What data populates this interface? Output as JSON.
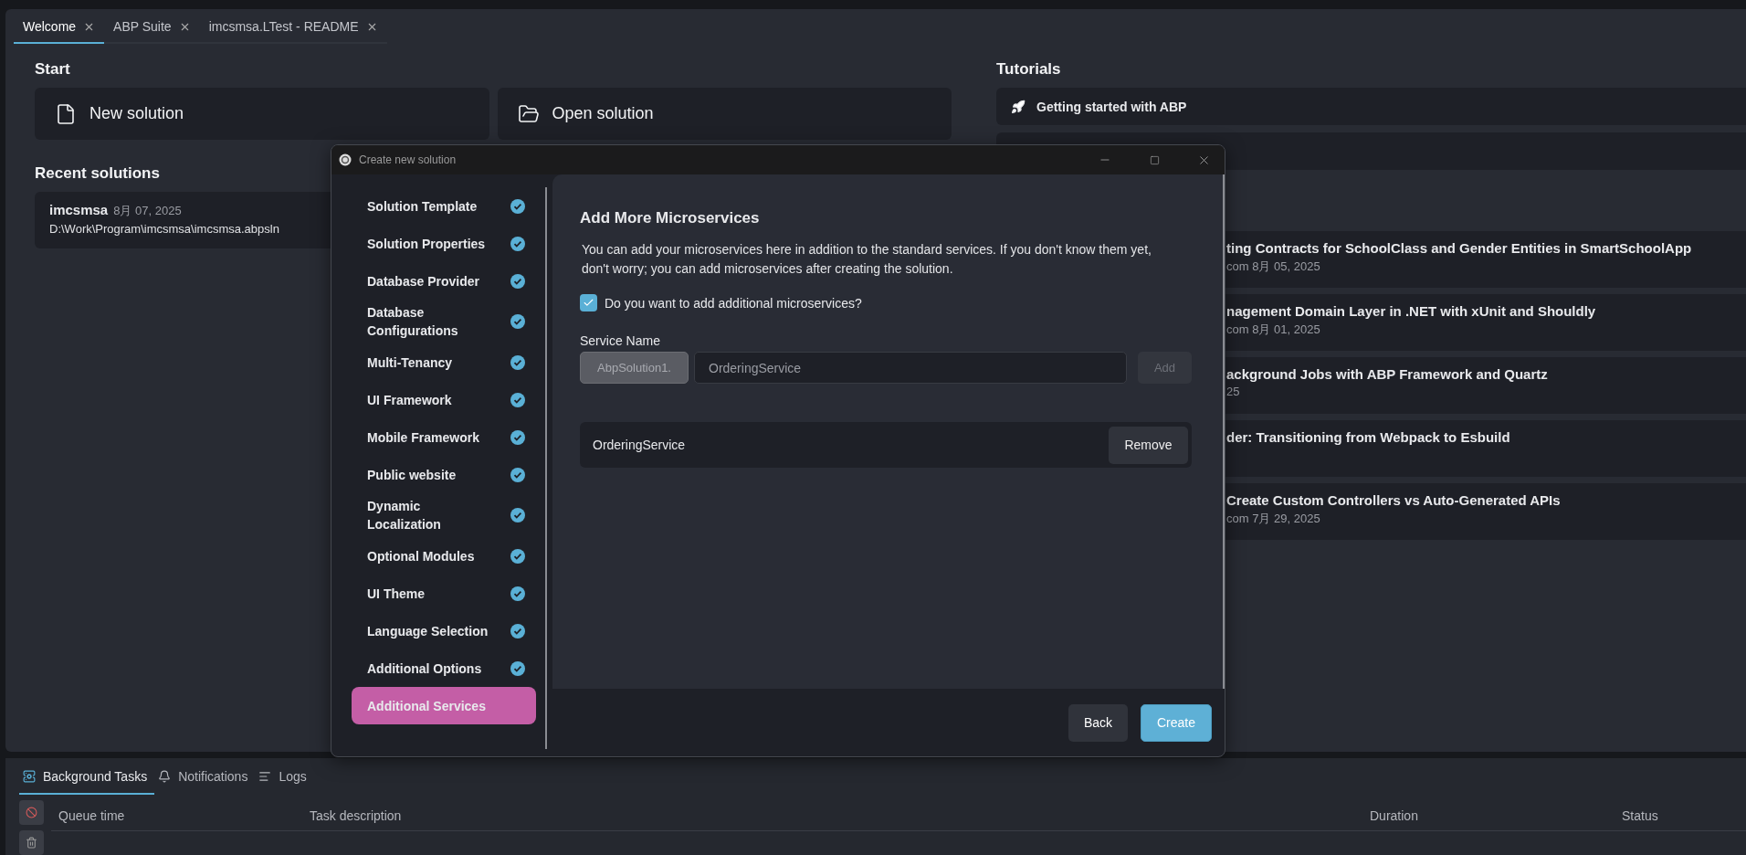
{
  "tabs": [
    {
      "label": "Welcome",
      "selected": true
    },
    {
      "label": "ABP Suite",
      "selected": false
    },
    {
      "label": "imcsmsa.LTest - README",
      "selected": false
    }
  ],
  "start": {
    "heading": "Start",
    "actions": [
      {
        "label": "New solution",
        "kind": "file"
      },
      {
        "label": "Open solution",
        "kind": "folder"
      }
    ]
  },
  "recent": {
    "heading": "Recent solutions",
    "items": [
      {
        "name": "imcsmsa",
        "date": "8月 07, 2025",
        "path": "D:\\Work\\Program\\imcsmsa\\imcsmsa.abpsln"
      }
    ]
  },
  "tutorials": {
    "heading": "Tutorials",
    "items": [
      {
        "kind": "link",
        "label": "Getting started with ABP"
      },
      {
        "kind": "covered"
      }
    ]
  },
  "articles": [
    {
      "title": "ting Contracts for SchoolClass and Gender Entities in SmartSchoolApp",
      "meta": "com 8月 05, 2025"
    },
    {
      "title": "nagement Domain Layer in .NET with xUnit and Shouldly",
      "meta": "com 8月 01, 2025"
    },
    {
      "title": "ackground Jobs with ABP Framework and Quartz",
      "meta": "25"
    },
    {
      "title": "der: Transitioning from Webpack to Esbuild"
    },
    {
      "title": "Create Custom Controllers vs Auto-Generated APIs",
      "meta": "com 7月 29, 2025"
    }
  ],
  "dialog": {
    "title": "Create new solution",
    "steps": [
      {
        "label": "Solution Template",
        "done": true,
        "selected": false
      },
      {
        "label": "Solution Properties",
        "done": true,
        "selected": false
      },
      {
        "label": "Database Provider",
        "done": true,
        "selected": false
      },
      {
        "label": "Database Configurations",
        "done": true,
        "selected": false
      },
      {
        "label": "Multi-Tenancy",
        "done": true,
        "selected": false
      },
      {
        "label": "UI Framework",
        "done": true,
        "selected": false
      },
      {
        "label": "Mobile Framework",
        "done": true,
        "selected": false
      },
      {
        "label": "Public website",
        "done": true,
        "selected": false
      },
      {
        "label": "Dynamic Localization",
        "done": true,
        "selected": false
      },
      {
        "label": "Optional Modules",
        "done": true,
        "selected": false
      },
      {
        "label": "UI Theme",
        "done": true,
        "selected": false
      },
      {
        "label": "Language Selection",
        "done": true,
        "selected": false
      },
      {
        "label": "Additional Options",
        "done": true,
        "selected": false
      },
      {
        "label": "Additional Services",
        "done": false,
        "selected": true
      }
    ],
    "heading": "Add More Microservices",
    "description": "You can add your microservices here in addition to the standard services. If you don't know them yet, don't worry; you can add microservices after creating the solution.",
    "checkbox": {
      "label": "Do you want to add additional microservices?",
      "checked": true
    },
    "service_name": {
      "label": "Service Name",
      "prefix": "AbpSolution1.",
      "placeholder": "OrderingService",
      "add_button": "Add",
      "add_disabled": true
    },
    "services": [
      {
        "name": "OrderingService",
        "action": "Remove"
      }
    ],
    "buttons": [
      {
        "label": "Back",
        "kind": "secondary"
      },
      {
        "label": "Create",
        "kind": "primary"
      }
    ]
  },
  "bottom_panel": {
    "tabs": [
      {
        "label": "Background Tasks",
        "kind": "tasks",
        "selected": true
      },
      {
        "label": "Notifications",
        "kind": "bell",
        "selected": false
      },
      {
        "label": "Logs",
        "kind": "lines",
        "selected": false
      }
    ],
    "columns": [
      "Queue time",
      "Task description",
      "Duration",
      "Status"
    ]
  }
}
